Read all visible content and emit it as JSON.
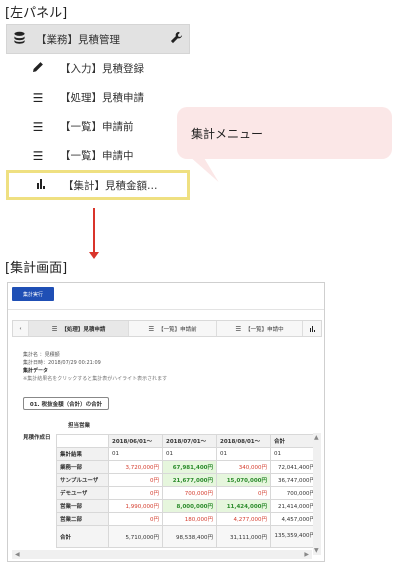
{
  "captions": {
    "left_panel": "[左パネル]",
    "summary_screen": "[集計画面]"
  },
  "panel": {
    "header_label": "【業務】見積管理",
    "items": [
      {
        "icon": "pencil-icon",
        "label": "【入力】見積登録"
      },
      {
        "icon": "list-icon",
        "label": "【処理】見積申請"
      },
      {
        "icon": "list-icon",
        "label": "【一覧】申請前"
      },
      {
        "icon": "list-icon",
        "label": "【一覧】申請中"
      },
      {
        "icon": "bar-chart-icon",
        "label": "【集計】見積金額…"
      }
    ]
  },
  "callout": "集計メニュー",
  "screen": {
    "run_button": "集計実行",
    "tabs": [
      {
        "icon": "‹",
        "label": ""
      },
      {
        "icon": "☰",
        "label": "【処理】見積申請"
      },
      {
        "icon": "☰",
        "label": "【一覧】申請前"
      },
      {
        "icon": "☰",
        "label": "【一覧】申請中"
      },
      {
        "icon": "▮",
        "label": ""
      }
    ],
    "info": {
      "name": "集計名 ：見積額",
      "date": "集計日時：2018/07/29 00:21:09",
      "data_header": "集計データ",
      "hint": "※集計結果名をクリックすると集計表がハイライト表示されます"
    },
    "aggregate_button": "01. 税抜金額（合計）の合計",
    "dept_header": "担当営業",
    "row_axis_label": "見積作成日",
    "columns": [
      "2018/06/01〜",
      "2018/07/01〜",
      "2018/08/01〜",
      "合計"
    ],
    "codes_label": "集計結果",
    "codes": [
      "01",
      "01",
      "01",
      "01"
    ],
    "rows": [
      {
        "label": "業務一部",
        "values": [
          "3,720,000円",
          "67,981,400円",
          "340,000円",
          "72,041,400円"
        ]
      },
      {
        "label": "サンプルユーザ",
        "values": [
          "0円",
          "21,677,000円",
          "15,070,000円",
          "36,747,000円"
        ]
      },
      {
        "label": "デモユーザ",
        "values": [
          "0円",
          "700,000円",
          "0円",
          "700,000円"
        ]
      },
      {
        "label": "営業一部",
        "values": [
          "1,990,000円",
          "8,000,000円",
          "11,424,000円",
          "21,414,000円"
        ]
      },
      {
        "label": "営業二部",
        "values": [
          "0円",
          "180,000円",
          "4,277,000円",
          "4,457,000円"
        ]
      }
    ],
    "total": {
      "label": "合計",
      "values": [
        "5,710,000円",
        "98,538,400円",
        "31,111,000円",
        "135,359,400円"
      ]
    },
    "colors": {
      "accent": "#1f4fb5",
      "highlight_border": "#efe081",
      "callout_bg": "#fbe7e7",
      "arrow": "#d9342b",
      "red_text": "#d43b2c",
      "green_text": "#2b8b2b",
      "green_bg": "#e6f6dd"
    }
  }
}
